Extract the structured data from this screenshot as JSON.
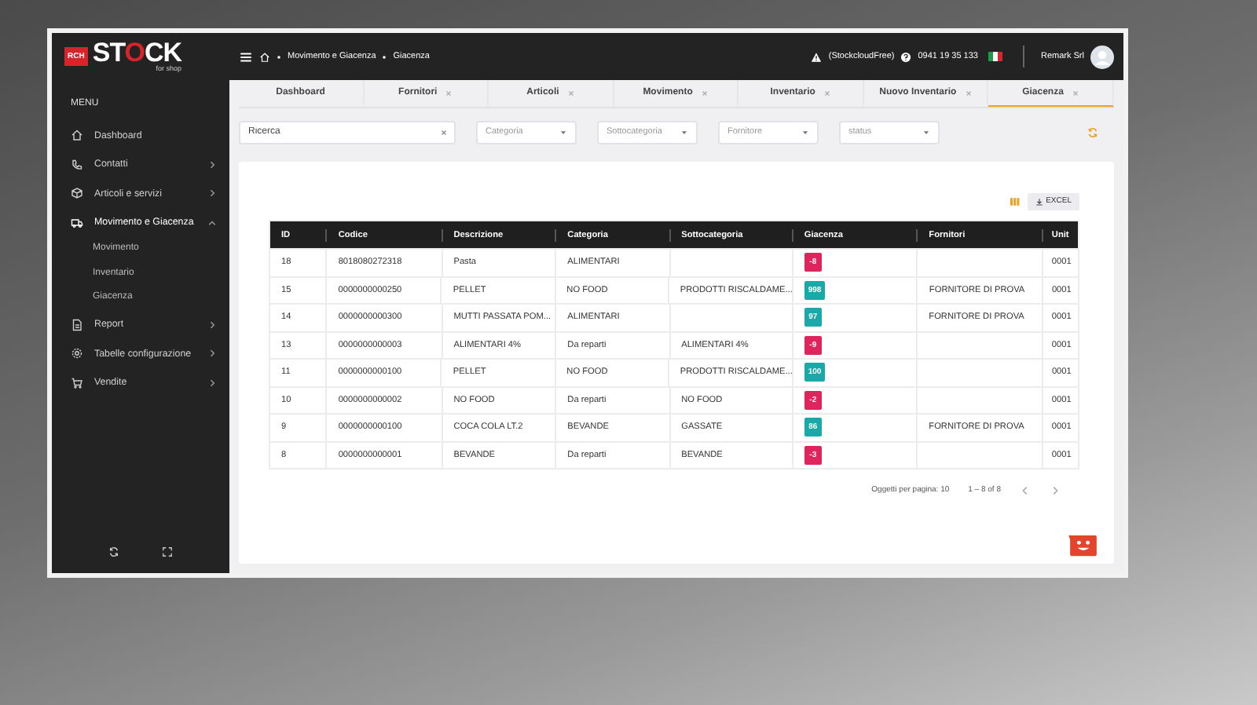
{
  "header": {
    "logo_badge": "RCH",
    "logo": "STOCK",
    "logo_sub": "for shop",
    "breadcrumb": [
      "Movimento e Giacenza",
      "Giacenza"
    ],
    "license": "(StockcloudFree)",
    "phone": "0941 19 35 133",
    "company": "Remark Srl"
  },
  "sidebar": {
    "menu_label": "MENU",
    "items": [
      {
        "label": "Dashboard",
        "selected": false
      },
      {
        "label": "Contatti",
        "selected": false,
        "expanded": false
      },
      {
        "label": "Articoli e servizi",
        "selected": false,
        "expanded": false
      },
      {
        "label": "Movimento e Giacenza",
        "selected": true,
        "expanded": true,
        "children": [
          {
            "label": "Movimento",
            "selected": false
          },
          {
            "label": "Inventario",
            "selected": false
          },
          {
            "label": "Giacenza",
            "selected": false
          }
        ]
      },
      {
        "label": "Report",
        "selected": false,
        "expanded": false
      },
      {
        "label": "Tabelle configurazione",
        "selected": false,
        "expanded": false
      },
      {
        "label": "Vendite",
        "selected": false,
        "expanded": false
      }
    ]
  },
  "tabs": [
    {
      "label": "Dashboard",
      "closable": false,
      "selected": false
    },
    {
      "label": "Fornitori",
      "closable": true,
      "selected": false
    },
    {
      "label": "Articoli",
      "closable": true,
      "selected": false
    },
    {
      "label": "Movimento",
      "closable": true,
      "selected": false
    },
    {
      "label": "Inventario",
      "closable": true,
      "selected": false
    },
    {
      "label": "Nuovo Inventario",
      "closable": true,
      "selected": false
    },
    {
      "label": "Giacenza",
      "closable": true,
      "selected": true
    }
  ],
  "filters": {
    "search": {
      "value": "Ricerca"
    },
    "dropdowns": [
      {
        "placeholder": "Categoria"
      },
      {
        "placeholder": "Sottocategoria"
      },
      {
        "placeholder": "Fornitore"
      },
      {
        "placeholder": "status"
      }
    ]
  },
  "toolbar": {
    "export_button": "EXCEL"
  },
  "table": {
    "columns": [
      "ID",
      "Codice",
      "Descrizione",
      "Categoria",
      "Sottocategoria",
      "Giacenza",
      "Fornitori",
      "Unit"
    ],
    "rows": [
      {
        "id": "18",
        "codice": "8018080272318",
        "descrizione": "Pasta",
        "categoria": "ALIMENTARI",
        "sottocategoria": "",
        "giacenza": "-8",
        "color": "#e0245e",
        "fornitori": "",
        "column_8": "0001"
      },
      {
        "id": "15",
        "codice": "0000000000250",
        "descrizione": "PELLET",
        "categoria": "NO FOOD",
        "sottocategoria": "PRODOTTI RISCALDAME...",
        "giacenza": "998",
        "color": "#1aa8a8",
        "fornitori": "FORNITORE DI PROVA",
        "column_8": "0001"
      },
      {
        "id": "14",
        "codice": "0000000000300",
        "descrizione": "MUTTI PASSATA POM...",
        "categoria": "ALIMENTARI",
        "sottocategoria": "",
        "giacenza": "97",
        "color": "#1aa8a8",
        "fornitori": "FORNITORE DI PROVA",
        "column_8": "0001"
      },
      {
        "id": "13",
        "codice": "0000000000003",
        "descrizione": "ALIMENTARI 4%",
        "categoria": "Da reparti",
        "sottocategoria": "ALIMENTARI 4%",
        "giacenza": "-9",
        "color": "#e0245e",
        "fornitori": "",
        "column_8": "0001"
      },
      {
        "id": "11",
        "codice": "0000000000100",
        "descrizione": "PELLET",
        "categoria": "NO FOOD",
        "sottocategoria": "PRODOTTI RISCALDAME...",
        "giacenza": "100",
        "color": "#1aa8a8",
        "fornitori": "",
        "column_8": "0001"
      },
      {
        "id": "10",
        "codice": "0000000000002",
        "descrizione": "NO FOOD",
        "categoria": "Da reparti",
        "sottocategoria": "NO FOOD",
        "giacenza": "-2",
        "color": "#e0245e",
        "fornitori": "",
        "column_8": "0001"
      },
      {
        "id": "9",
        "codice": "0000000000100",
        "descrizione": "COCA COLA LT.2",
        "categoria": "BEVANDE",
        "sottocategoria": "GASSATE",
        "giacenza": "86",
        "color": "#1aa8a8",
        "fornitori": "FORNITORE DI PROVA",
        "column_8": "0001"
      },
      {
        "id": "8",
        "codice": "0000000000001",
        "descrizione": "BEVANDE",
        "categoria": "Da reparti",
        "sottocategoria": "BEVANDE",
        "giacenza": "-3",
        "color": "#e0245e",
        "fornitori": "",
        "column_8": "0001"
      }
    ]
  },
  "pagination": {
    "per_page": "Oggetti per pagina: 10",
    "range": "1 – 8 of 8"
  }
}
